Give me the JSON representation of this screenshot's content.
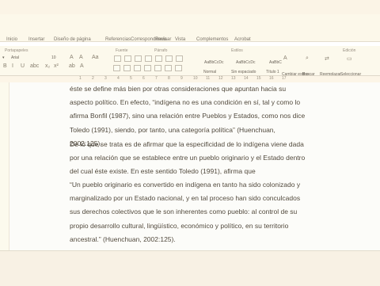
{
  "menu": [
    "Inicio",
    "Insertar",
    "Diseño de página",
    "Referencias",
    "Correspondencia",
    "Revisar",
    "Vista",
    "Complementos",
    "Acrobat"
  ],
  "ribbon": {
    "groups": [
      "Portapapeles",
      "Fuente",
      "Párrafo",
      "Estilos",
      "Edición"
    ],
    "font_name": "Arial",
    "font_size": "10",
    "style_1": "AaBbCcDc",
    "style_2": "AaBbCcDc",
    "style_3": "AaBbC",
    "style_label_1": "Normal",
    "style_label_2": "Sin espaciado",
    "style_label_3": "Título 1",
    "change_styles": "Cambiar estilos",
    "find": "Buscar",
    "replace": "Reemplazar",
    "select": "Seleccionar"
  },
  "ruler": {
    "numbers": [
      "1",
      "2",
      "3",
      "4",
      "5",
      "6",
      "7",
      "8",
      "9",
      "10",
      "11",
      "12",
      "13",
      "14",
      "15",
      "16",
      "17"
    ]
  },
  "document": {
    "paragraph_1": "éste se define más bien por otras consideraciones que apuntan hacia su aspecto político. En efecto, “indígena no es una condición en sí, tal y como lo afirma Bonfil (1987), sino una relación entre Pueblos y Estados, como nos dice Toledo (1991), siendo, por tanto, una categoría política” (Huenchuan, 2002:125).",
    "paragraph_2": "De lo que se trata es de afirmar que la especificidad de lo indígena viene dada por una relación que se establece entre un pueblo originario y el Estado dentro del cual éste existe. En este sentido Toledo (1991), afirma que",
    "paragraph_3": "“Un pueblo originario es convertido en indígena en tanto ha sido colonizado y marginalizado por un Estado nacional, y en tal proceso han sido conculcados sus derechos colectivos que le son inherentes como pueblo: al control de su propio desarrollo cultural, lingüístico, económico y político, en su territorio ancestral.” (Huenchuan, 2002:125)."
  }
}
